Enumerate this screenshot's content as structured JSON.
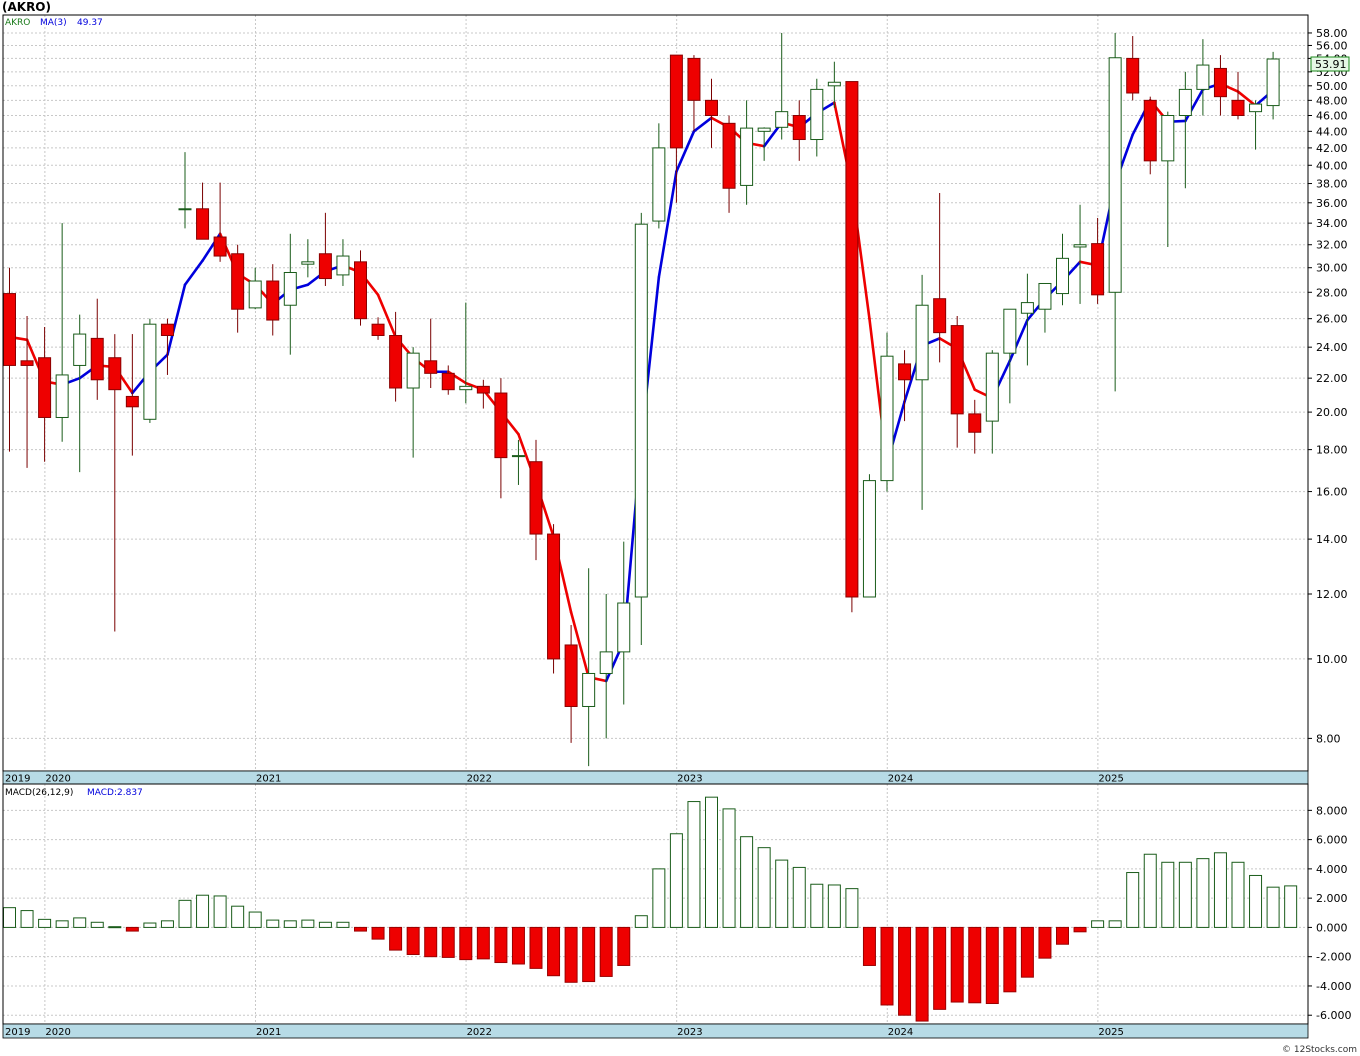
{
  "header": {
    "title": "(AKRO)",
    "legend_symbol": "AKRO",
    "legend_ma_label": "MA(3)",
    "legend_ma_value": "49.37",
    "last_price_tag": "53.91"
  },
  "macd_panel": {
    "label": "MACD(26,12,9)",
    "value_label": "MACD:2.837"
  },
  "footer": {
    "watermark": "© 12Stocks.com"
  },
  "colors": {
    "up_candle": "#1a5c1a",
    "down_candle": "#ee0000",
    "ma_up": "#0000dd",
    "ma_down": "#ee0000",
    "axis_band": "#b7dbe6",
    "grid": "#c8c8c8",
    "price_tag_bg": "#e6f7e6",
    "price_tag_border": "#1a8a1a"
  },
  "chart_data": [
    {
      "type": "candlestick",
      "panel": "price",
      "scale": "log",
      "ylim": [
        7.3,
        61
      ],
      "yticks": [
        "8.00",
        "10.00",
        "12.00",
        "14.00",
        "16.00",
        "18.00",
        "20.00",
        "22.00",
        "24.00",
        "26.00",
        "28.00",
        "30.00",
        "32.00",
        "34.00",
        "36.00",
        "38.00",
        "40.00",
        "42.00",
        "44.00",
        "46.00",
        "48.00",
        "50.00",
        "52.00",
        "54.00",
        "56.00",
        "58.00"
      ],
      "year_labels": [
        {
          "year": "2019",
          "index": -1.2
        },
        {
          "year": "2020",
          "index": 2.5
        },
        {
          "year": "2021",
          "index": 14.5
        },
        {
          "year": "2022",
          "index": 26.5
        },
        {
          "year": "2023",
          "index": 38.5
        },
        {
          "year": "2024",
          "index": 50.5
        },
        {
          "year": "2025",
          "index": 62.5
        }
      ],
      "grid": true,
      "candles": [
        [
          27.9,
          30.0,
          17.9,
          22.8
        ],
        [
          23.1,
          26.2,
          17.1,
          22.8
        ],
        [
          23.3,
          25.4,
          17.4,
          19.7
        ],
        [
          19.7,
          34.0,
          18.4,
          22.2
        ],
        [
          22.8,
          26.3,
          16.9,
          24.9
        ],
        [
          24.6,
          27.5,
          20.7,
          21.9
        ],
        [
          23.3,
          24.9,
          10.8,
          21.3
        ],
        [
          20.9,
          24.9,
          17.7,
          20.3
        ],
        [
          19.6,
          26.0,
          19.4,
          25.6
        ],
        [
          25.6,
          26.0,
          22.2,
          24.8
        ],
        [
          35.4,
          41.5,
          33.5,
          35.4
        ],
        [
          35.4,
          38.1,
          32.5,
          32.5
        ],
        [
          32.7,
          38.1,
          30.5,
          31.0
        ],
        [
          31.2,
          32.0,
          25.0,
          26.7
        ],
        [
          26.8,
          30.0,
          26.7,
          28.9
        ],
        [
          28.9,
          30.3,
          24.8,
          25.9
        ],
        [
          27.0,
          33.0,
          23.5,
          29.6
        ],
        [
          30.3,
          32.5,
          29.2,
          30.5
        ],
        [
          31.2,
          35.0,
          28.5,
          29.1
        ],
        [
          29.4,
          32.5,
          28.5,
          31.0
        ],
        [
          30.5,
          31.5,
          25.5,
          26.0
        ],
        [
          25.6,
          26.1,
          24.5,
          24.8
        ],
        [
          24.8,
          26.5,
          20.6,
          21.4
        ],
        [
          21.4,
          24.0,
          17.6,
          23.6
        ],
        [
          23.1,
          26.0,
          21.4,
          22.3
        ],
        [
          22.3,
          22.8,
          21.0,
          21.3
        ],
        [
          21.3,
          27.2,
          20.5,
          21.5
        ],
        [
          21.5,
          21.9,
          20.2,
          21.1
        ],
        [
          21.1,
          22.0,
          15.7,
          17.6
        ],
        [
          17.7,
          18.5,
          16.3,
          17.7
        ],
        [
          17.4,
          18.5,
          13.2,
          14.2
        ],
        [
          14.2,
          14.6,
          9.6,
          10.0
        ],
        [
          10.4,
          11.0,
          7.9,
          8.75
        ],
        [
          8.75,
          12.9,
          7.4,
          9.6
        ],
        [
          9.6,
          12.0,
          8.0,
          10.2
        ],
        [
          10.2,
          13.9,
          8.8,
          11.7
        ],
        [
          11.9,
          35.0,
          10.4,
          33.9
        ],
        [
          34.2,
          45.0,
          33.5,
          42.0
        ],
        [
          54.5,
          54.5,
          36.0,
          42.0
        ],
        [
          54.0,
          54.5,
          44.0,
          48.0
        ],
        [
          48.0,
          51.0,
          42.0,
          46.0
        ],
        [
          45.0,
          46.0,
          35.0,
          37.5
        ],
        [
          37.8,
          48.0,
          35.8,
          44.4
        ],
        [
          44.0,
          44.5,
          40.5,
          44.4
        ],
        [
          44.5,
          58.0,
          43.0,
          46.5
        ],
        [
          46.0,
          48.0,
          40.5,
          43.0
        ],
        [
          43.0,
          51.0,
          41.0,
          49.5
        ],
        [
          50.0,
          53.5,
          47.0,
          50.5
        ],
        [
          50.6,
          50.6,
          11.4,
          11.9
        ],
        [
          11.9,
          16.8,
          11.9,
          16.5
        ],
        [
          16.5,
          25.0,
          16.0,
          23.4
        ],
        [
          22.9,
          23.8,
          19.5,
          21.9
        ],
        [
          21.9,
          29.4,
          15.2,
          27.0
        ],
        [
          27.5,
          37.0,
          23.0,
          25.0
        ],
        [
          25.5,
          26.2,
          18.1,
          19.9
        ],
        [
          19.9,
          20.7,
          17.8,
          18.9
        ],
        [
          19.5,
          23.8,
          17.8,
          23.6
        ],
        [
          23.6,
          26.5,
          20.5,
          26.7
        ],
        [
          26.4,
          29.5,
          22.8,
          27.2
        ],
        [
          26.7,
          28.5,
          25.0,
          28.7
        ],
        [
          27.9,
          33.0,
          27.0,
          30.8
        ],
        [
          31.8,
          35.8,
          27.1,
          32.0
        ],
        [
          32.1,
          34.5,
          27.1,
          27.8
        ],
        [
          28.0,
          58.0,
          21.2,
          54.1
        ],
        [
          54.0,
          57.5,
          48.0,
          49.0
        ],
        [
          48.0,
          48.5,
          39.0,
          40.5
        ],
        [
          40.5,
          46.5,
          31.8,
          46.0
        ],
        [
          46.0,
          52.0,
          37.5,
          49.5
        ],
        [
          49.5,
          57.0,
          46.0,
          53.0
        ],
        [
          52.5,
          54.5,
          46.0,
          48.5
        ],
        [
          48.0,
          52.0,
          45.5,
          46.0
        ],
        [
          46.5,
          48.0,
          41.8,
          47.5
        ],
        [
          47.3,
          55.0,
          45.5,
          53.91
        ]
      ],
      "candle_fields": [
        "open",
        "high",
        "low",
        "close"
      ],
      "ma3": [
        24.7,
        24.5,
        21.8,
        21.6,
        22.0,
        22.8,
        22.7,
        21.1,
        22.4,
        23.5,
        28.6,
        30.6,
        33.0,
        29.5,
        28.6,
        27.1,
        28.2,
        28.6,
        29.7,
        30.2,
        29.6,
        27.8,
        24.7,
        23.3,
        22.4,
        22.4,
        21.7,
        21.3,
        20.0,
        18.8,
        16.4,
        14.1,
        11.4,
        9.5,
        9.4,
        10.5,
        18.5,
        29.2,
        39.3,
        44.0,
        45.7,
        44.5,
        42.6,
        42.2,
        45.1,
        44.5,
        46.3,
        47.7,
        37.6,
        26.0,
        17.3,
        20.6,
        24.1,
        24.6,
        23.9,
        21.3,
        20.8,
        23.1,
        25.9,
        27.5,
        28.9,
        30.5,
        30.2,
        38.0,
        43.6,
        48.0,
        45.2,
        45.3,
        49.5,
        50.3,
        49.2,
        47.3,
        49.37
      ]
    },
    {
      "type": "bar",
      "panel": "macd",
      "series_label": "MACD(26,12,9)",
      "ylim": [
        -6.6,
        9.8
      ],
      "yticks": [
        "8.000",
        "6.000",
        "4.000",
        "2.000",
        "0.000",
        "-2.000",
        "-4.000",
        "-6.000"
      ],
      "grid": true,
      "values": [
        1.35,
        1.15,
        0.55,
        0.45,
        0.65,
        0.35,
        0.05,
        -0.25,
        0.3,
        0.45,
        1.85,
        2.2,
        2.15,
        1.45,
        1.05,
        0.5,
        0.45,
        0.5,
        0.35,
        0.35,
        -0.25,
        -0.8,
        -1.55,
        -1.85,
        -2.0,
        -2.05,
        -2.2,
        -2.15,
        -2.4,
        -2.5,
        -2.8,
        -3.3,
        -3.75,
        -3.7,
        -3.35,
        -2.6,
        0.8,
        4.0,
        6.4,
        8.6,
        8.9,
        8.1,
        6.2,
        5.45,
        4.6,
        4.1,
        2.95,
        2.9,
        2.65,
        -2.6,
        -5.3,
        -6.0,
        -6.4,
        -5.6,
        -5.1,
        -5.15,
        -5.2,
        -4.4,
        -3.4,
        -2.1,
        -1.15,
        -0.3,
        0.45,
        0.45,
        3.75,
        5.0,
        4.45,
        4.45,
        4.7,
        5.1,
        4.45,
        3.55,
        2.75,
        2.837
      ]
    }
  ]
}
